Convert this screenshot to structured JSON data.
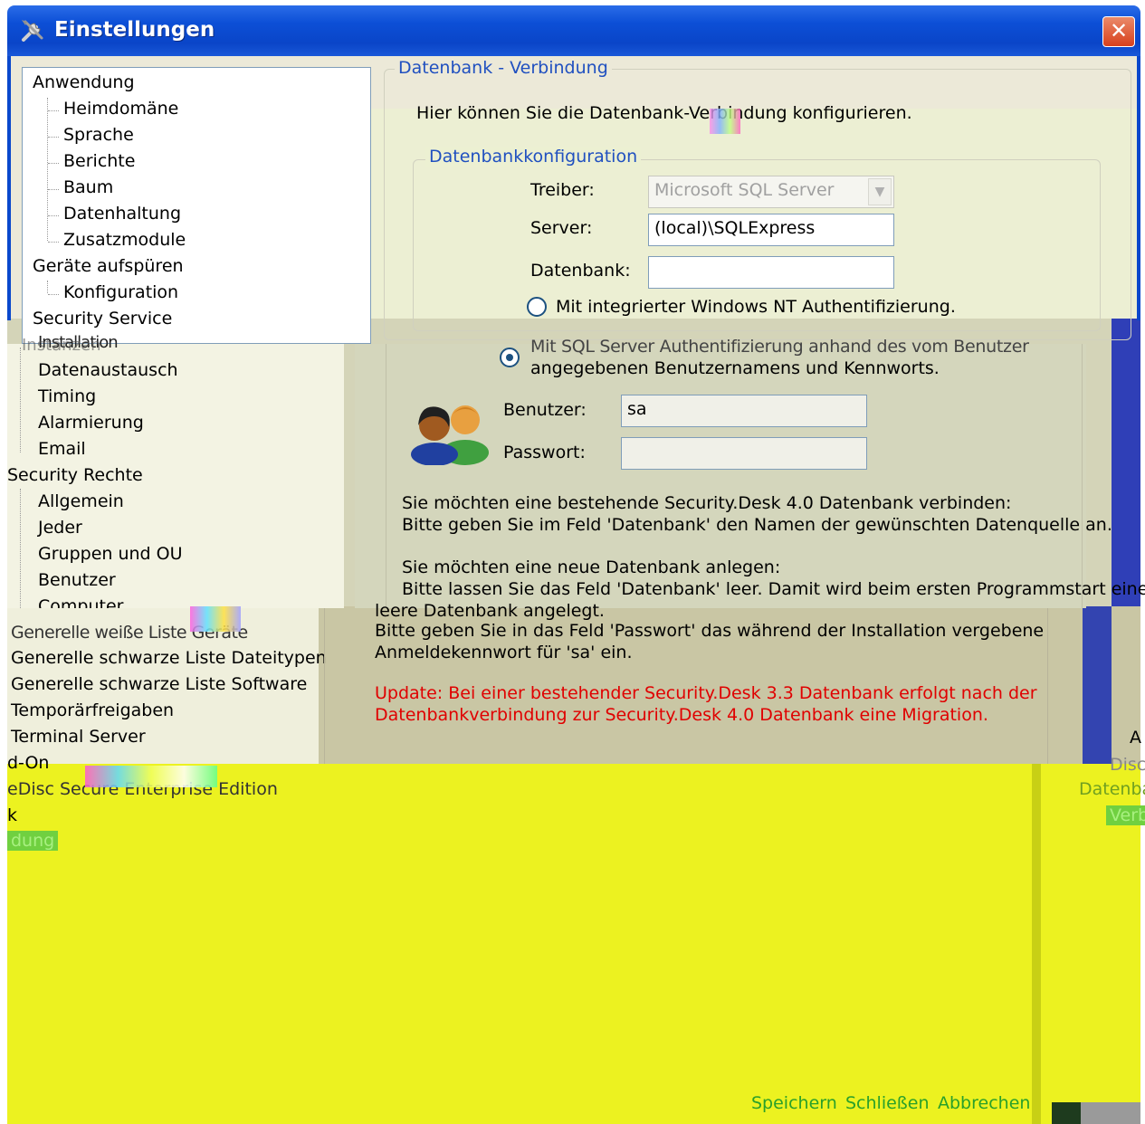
{
  "window": {
    "title": "Einstellungen",
    "close_glyph": "✕"
  },
  "tree": {
    "items_top": [
      {
        "label": "Anwendung",
        "level": 0
      },
      {
        "label": "Heimdomäne",
        "level": 1
      },
      {
        "label": "Sprache",
        "level": 1
      },
      {
        "label": "Berichte",
        "level": 1
      },
      {
        "label": "Baum",
        "level": 1
      },
      {
        "label": "Datenhaltung",
        "level": 1
      },
      {
        "label": "Zusatzmodule",
        "level": 1
      },
      {
        "label": "Geräte aufspüren",
        "level": 0
      },
      {
        "label": "Konfiguration",
        "level": 1
      },
      {
        "label": "Security Service",
        "level": 0
      }
    ],
    "items_mid": [
      {
        "label": "Datenaustausch"
      },
      {
        "label": "Timing"
      },
      {
        "label": "Alarmierung"
      },
      {
        "label": "Email"
      },
      {
        "label": "Security Rechte"
      },
      {
        "label": "Allgemein"
      },
      {
        "label": "Jeder"
      },
      {
        "label": "Gruppen und OU"
      },
      {
        "label": "Benutzer"
      },
      {
        "label": "Computer"
      }
    ],
    "overlap_mid": "Installation",
    "overlap_mid_ghost": "Instanzen",
    "overlap_low": "Generelle weiße Liste Geräte",
    "items_low": [
      {
        "label": "Generelle schwarze Liste Dateitypen"
      },
      {
        "label": "Generelle schwarze Liste Software"
      },
      {
        "label": "Temporärfreigaben"
      },
      {
        "label": "Terminal Server"
      }
    ],
    "fragments_yellow": [
      {
        "label": "d-On"
      },
      {
        "label": "eDisc Secure Enterprise Edition"
      },
      {
        "label": "k"
      },
      {
        "label": "dung"
      }
    ]
  },
  "panel": {
    "group_label": "Datenbank - Verbindung",
    "intro": "Hier können Sie die Datenbank-Verbindung konfigurieren.",
    "config_group_label": "Datenbankkonfiguration",
    "driver_label": "Treiber:",
    "driver_value": "Microsoft SQL Server",
    "server_label": "Server:",
    "server_value": "(local)\\SQLExpress",
    "database_label": "Datenbank:",
    "database_value": "",
    "radio_windows": "Mit integrierter Windows NT Authentifizierung.",
    "radio_sql_line1": "Mit SQL Server Authentifizierung anhand des vom Benutzer",
    "radio_sql_line2": "angegebenen Benutzernamens und Kennworts.",
    "user_label": "Benutzer:",
    "user_value": "sa",
    "password_label": "Passwort:",
    "password_value": "",
    "info_existing_1": "Sie möchten eine bestehende Security.Desk 4.0 Datenbank verbinden:",
    "info_existing_2": "Bitte geben Sie im Feld 'Datenbank' den Namen der gewünschten Datenquelle an.",
    "info_new_1": "Sie möchten eine neue Datenbank anlegen:",
    "info_new_2": "Bitte lassen Sie das Feld 'Datenbank' leer. Damit wird beim ersten Programmstart eine",
    "info_new_3": "leere Datenbank angelegt.",
    "info_pw_1": "Bitte geben Sie in das Feld 'Passwort' das während der Installation vergebene",
    "info_pw_2": "Anmeldekennwort für 'sa' ein.",
    "update_1": "Update: Bei einer bestehender Security.Desk 3.3 Datenbank erfolgt nach der",
    "update_2": "Datenbankverbindung zur Security.Desk 4.0 Datenbank eine Migration."
  },
  "buttons": {
    "save": "Speichern",
    "close": "Schließen",
    "cancel": "Abbrechen"
  },
  "right_fragments": {
    "a": "A",
    "disc": "Disc",
    "datenba": "Datenba",
    "verb": "Verb"
  },
  "colors": {
    "titlebar": "#0a45c8",
    "group_label": "#2050c0",
    "update_text": "#e00000",
    "glitch_yellow": "#ecf220",
    "button_text": "#2aa02a"
  }
}
